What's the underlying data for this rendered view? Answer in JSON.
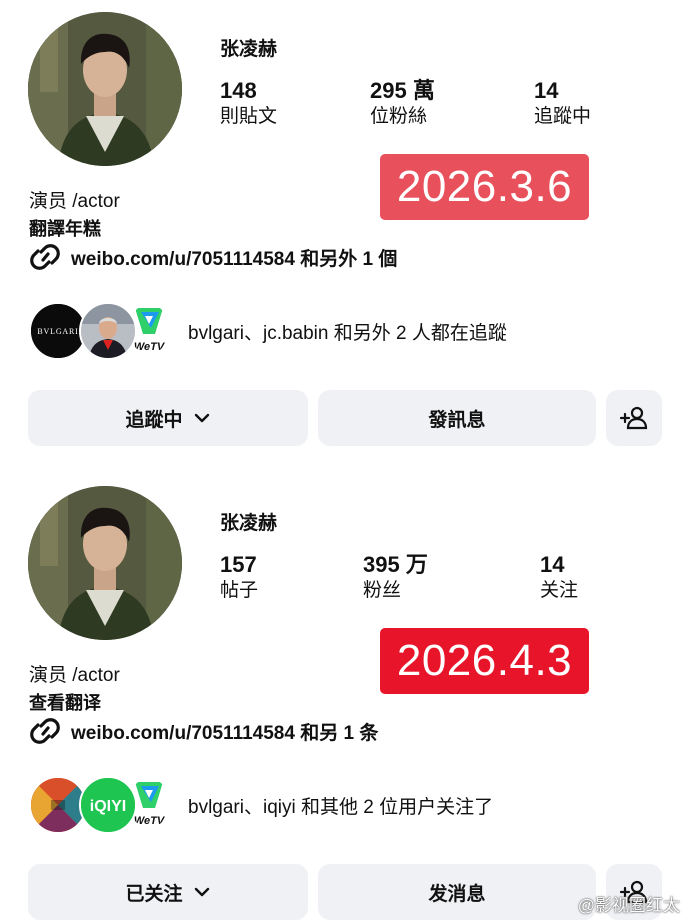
{
  "panels": [
    {
      "username": "张凌赫",
      "stats": [
        {
          "value": "148",
          "label": "則貼文"
        },
        {
          "value": "295 萬",
          "label": "位粉絲"
        },
        {
          "value": "14",
          "label": "追蹤中"
        }
      ],
      "date_badge": "2026.3.6",
      "date_badge_color": "#e8505c",
      "bio_line1": "演员 /actor",
      "bio_line2": "翻譯年糕",
      "link_text": "weibo.com/u/7051114584 和另外 1 個",
      "mutual_text": "bvlgari、jc.babin 和另外 2 人都在追蹤",
      "logo_bvlgari": "BVLGARI",
      "logo_wetv": "WeTV",
      "follow_button": "追蹤中",
      "message_button": "發訊息",
      "icons": [
        "link-icon",
        "chevron-down-icon",
        "add-person-icon"
      ]
    },
    {
      "username": "张凌赫",
      "stats": [
        {
          "value": "157",
          "label": "帖子"
        },
        {
          "value": "395 万",
          "label": "粉丝"
        },
        {
          "value": "14",
          "label": "关注"
        }
      ],
      "date_badge": "2026.4.3",
      "date_badge_color": "#e8142a",
      "bio_line1": "演员 /actor",
      "bio_line2": "查看翻译",
      "link_text": "weibo.com/u/7051114584 和另 1 条",
      "mutual_text": "bvlgari、iqiyi 和其他 2 位用户关注了",
      "logo_iqiyi": "iQIYI",
      "logo_wetv": "WeTV",
      "follow_button": "已关注",
      "message_button": "发消息",
      "icons": [
        "link-icon",
        "chevron-down-icon",
        "add-person-icon"
      ]
    }
  ],
  "watermark": "@影视圈红太"
}
